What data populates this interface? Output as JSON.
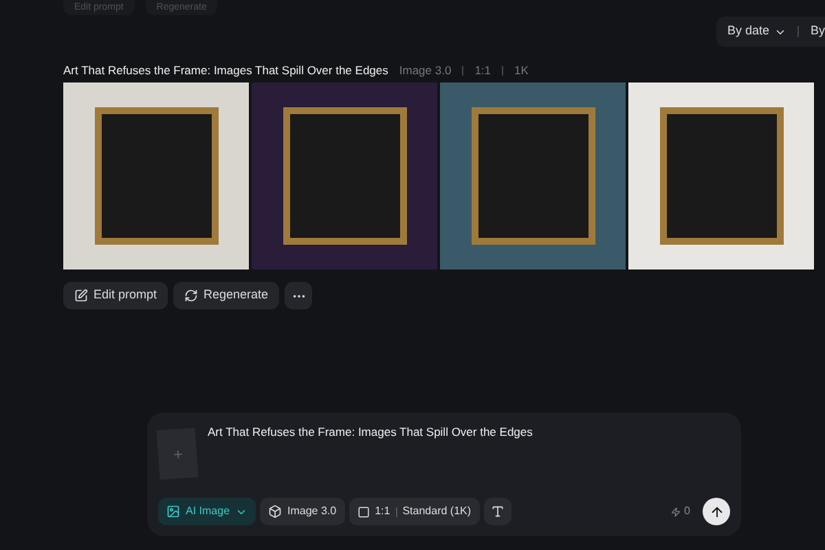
{
  "previous_actions": [
    "Edit prompt",
    "Regenerate"
  ],
  "sort": {
    "options": [
      "By date",
      "By"
    ]
  },
  "generation": {
    "prompt": "Art That Refuses the Frame: Images That Spill Over the Edges",
    "tags": [
      "Image 3.0",
      "1:1",
      "1K"
    ],
    "actions": [
      {
        "kind": "edit",
        "label": "Edit prompt"
      },
      {
        "kind": "regenerate",
        "label": "Regenerate"
      },
      {
        "kind": "more"
      }
    ]
  },
  "composer": {
    "prompt": "Art That Refuses the Frame: Images That Spill Over the Edges",
    "mode": "AI Image",
    "model": "Image 3.0",
    "ratio": "1:1",
    "quality": "Standard (1K)",
    "credits": "0"
  }
}
